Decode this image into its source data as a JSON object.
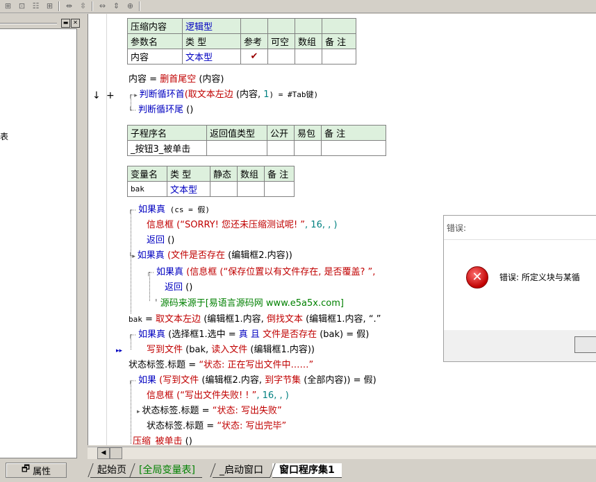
{
  "toolbar": {
    "icons": [
      "table-insert-icon",
      "table-col-icon",
      "table-row-icon",
      "table-split-icon",
      "dist-cols-icon",
      "dist-rows-icon",
      "align-width-icon",
      "align-height-icon",
      "merge-cells-icon"
    ]
  },
  "left_panel": {
    "stub_text": "表",
    "properties_button": "属性"
  },
  "param_table": {
    "header": [
      "压缩内容",
      "逻辑型",
      "",
      "",
      "",
      ""
    ],
    "sub_header": [
      "参数名",
      "类 型",
      "参考",
      "可空",
      "数组",
      "备 注"
    ],
    "row": [
      "内容",
      "文本型",
      "✔",
      "",
      "",
      ""
    ]
  },
  "sub_table": {
    "header": [
      "子程序名",
      "返回值类型",
      "公开",
      "易包",
      "备 注"
    ],
    "row": [
      "_按钮3_被单击",
      "",
      "",
      "",
      ""
    ]
  },
  "var_table": {
    "header": [
      "变量名",
      "类 型",
      "静态",
      "数组",
      "备 注"
    ],
    "row": [
      "bak",
      "文本型",
      "",
      "",
      ""
    ]
  },
  "code": {
    "l1_var": "内容",
    "l1_op": " = ",
    "l1_fn": "删首尾空",
    "l1_args": " (内容)",
    "l2_kw": "判断循环首",
    "l2_fn": "(取文本左边",
    "l2_args": " (内容, ",
    "l2_num": "1",
    "l2_rest": ") = #Tab键)",
    "l3_kw": "判断循环尾",
    "l3_rest": " ()",
    "b1_kw": "如果真",
    "b1_rest": " (cs = 假)",
    "b2_fn": "信息框",
    "b2_str": " (“SORRY! 您还未压缩测试呢! ”",
    "b2_rest": ", 16, , )",
    "b3_kw": "返回",
    "b3_rest": " ()",
    "b4_kw": "如果真",
    "b4_fn": " (文件是否存在",
    "b4_rest": " (编辑框2.内容))",
    "b5_kw": "如果真",
    "b5_fn": " (信息框",
    "b5_str": " (“保存位置以有文件存在, 是否覆盖? ”,",
    "b6_kw": "返回",
    "b6_rest": " ()",
    "b7_comment": "源码来源于[易语言源码网 www.e5a5x.com]",
    "b8_var": "bak",
    "b8_op": " = ",
    "b8_fn": "取文本左边",
    "b8_args": " (编辑框1.内容, ",
    "b8_fn2": "倒找文本",
    "b8_args2": " (编辑框1.内容, “.”",
    "b9_kw": "如果真",
    "b9_rest": " (选择框1.选中 = ",
    "b9_kw2": "真 且",
    "b9_fn": " 文件是否存在",
    "b9_rest2": " (bak) = 假)",
    "b10_fn": "写到文件",
    "b10_args": " (bak, ",
    "b10_fn2": "读入文件",
    "b10_rest": " (编辑框1.内容))",
    "b11_var": "状态标签.标题",
    "b11_op": " = ",
    "b11_str": "“状态: 正在写出文件中……”",
    "b12_kw": "如果",
    "b12_fn": " (写到文件",
    "b12_args": " (编辑框2.内容, ",
    "b12_fn2": "到字节集",
    "b12_rest": " (全部内容)) = 假)",
    "b13_fn": "信息框",
    "b13_str": " (“写出文件失败! ! ”",
    "b13_rest": ", 16, , )",
    "b14_var": "状态标签.标题",
    "b14_op": " = ",
    "b14_str": "“状态: 写出失败”",
    "b15_var": "状态标签.标题",
    "b15_op": " = ",
    "b15_str": "“状态: 写出完毕”",
    "b16_fn": "压缩_被单击",
    "b16_rest": " ()"
  },
  "gutter": {
    "down_arrow": "↓",
    "plus": "+",
    "marker": "▸▸"
  },
  "dialog": {
    "title": "错误:",
    "icon_glyph": "✕",
    "message": "错误: 所定义块与某循"
  },
  "tabs": [
    "起始页",
    "[全局变量表]",
    "_启动窗口",
    "窗口程序集1"
  ]
}
